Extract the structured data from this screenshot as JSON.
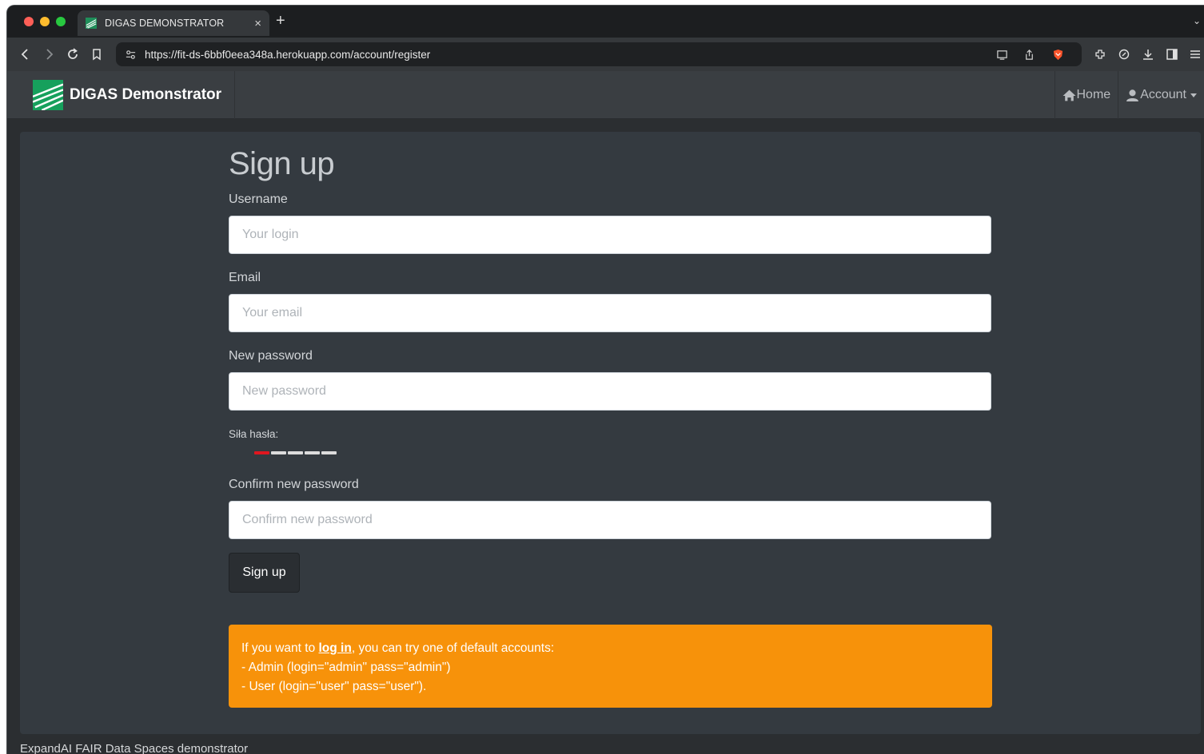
{
  "browser": {
    "tab_title": "DIGAS DEMONSTRATOR",
    "tab_close": "×",
    "new_tab": "+",
    "url": "https://fit-ds-6bbf0eea348a.herokuapp.com/account/register"
  },
  "navbar": {
    "brand": "DIGAS Demonstrator",
    "home": "Home",
    "account": "Account"
  },
  "form": {
    "title": "Sign up",
    "username_label": "Username",
    "username_placeholder": "Your login",
    "email_label": "Email",
    "email_placeholder": "Your email",
    "password_label": "New password",
    "password_placeholder": "New password",
    "strength_label": "Siła hasła:",
    "strength_colors": [
      "#e0161f",
      "#dcdcdc",
      "#dcdcdc",
      "#dcdcdc",
      "#dcdcdc"
    ],
    "confirm_label": "Confirm new password",
    "confirm_placeholder": "Confirm new password",
    "submit": "Sign up"
  },
  "alert": {
    "prefix": "If you want to ",
    "link": "log in",
    "suffix": ", you can try one of default accounts:",
    "line2": "- Admin (login=\"admin\" pass=\"admin\")",
    "line3": "- User (login=\"user\" pass=\"user\")."
  },
  "footer": "ExpandAI FAIR Data Spaces demonstrator",
  "colors": {
    "alert_bg": "#f7920a",
    "navbar_bg": "#3a3e42",
    "content_bg": "#343a40"
  }
}
